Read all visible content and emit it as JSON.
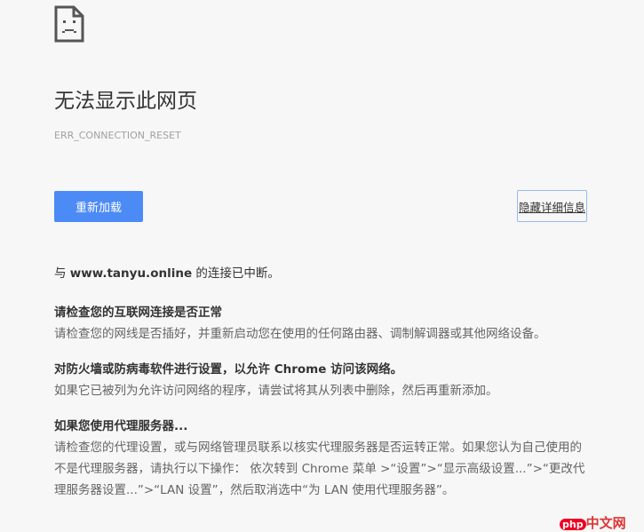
{
  "title": "无法显示此网页",
  "error_code": "ERR_CONNECTION_RESET",
  "buttons": {
    "reload": "重新加载",
    "hide_details": "隐藏详细信息"
  },
  "summary": {
    "prefix": "与 ",
    "host": "www.tanyu.online",
    "suffix": " 的连接已中断。"
  },
  "sections": [
    {
      "heading": "请检查您的互联网连接是否正常",
      "text": "请检查您的网线是否插好，并重新启动您在使用的任何路由器、调制解调器或其他网络设备。"
    },
    {
      "heading": "对防火墙或防病毒软件进行设置，以允许 Chrome 访问该网络。",
      "text": "如果它已被列为允许访问网络的程序，请尝试将其从列表中删除，然后再重新添加。"
    },
    {
      "heading": "如果您使用代理服务器...",
      "text": "请检查您的代理设置，或与网络管理员联系以核实代理服务器是否运转正常。如果您认为自己使用的不是代理服务器，请执行以下操作： 依次转到 Chrome 菜单 >“设置”>“显示高级设置...”>“更改代理服务器设置...”>“LAN 设置”，然后取消选中“为 LAN 使用代理服务器”。"
    }
  ],
  "watermark": {
    "badge": "php",
    "text": "中文网"
  }
}
